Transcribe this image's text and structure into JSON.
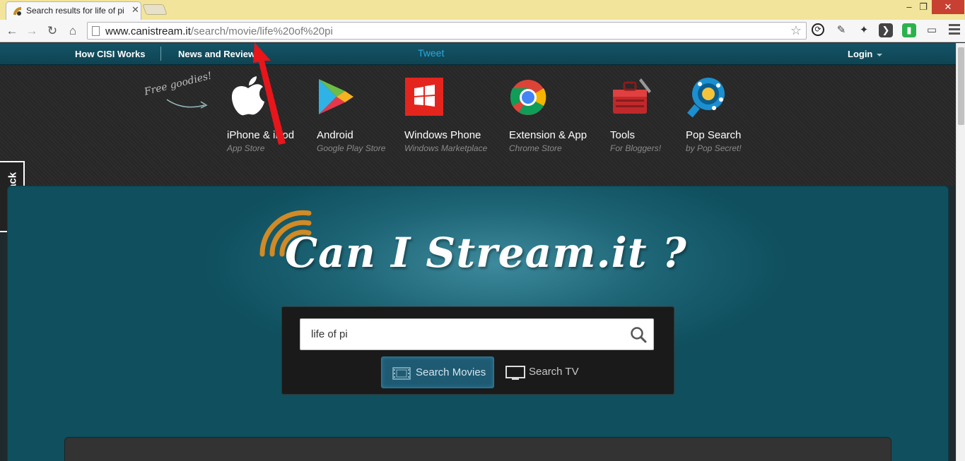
{
  "browser": {
    "tab_title": "Search results for life of pi",
    "url_host": "www.canistream.it",
    "url_path": "/search/movie/life%20of%20pi"
  },
  "site_nav": {
    "how_link": "How CISI Works",
    "news_link": "News and Reviews",
    "tweet": "Tweet",
    "login": "Login"
  },
  "goodies": {
    "tag": "Free goodies!",
    "apps": [
      {
        "name": "iPhone & iPod",
        "sub": "App Store"
      },
      {
        "name": "Android",
        "sub": "Google Play Store"
      },
      {
        "name": "Windows Phone",
        "sub": "Windows Marketplace"
      },
      {
        "name": "Extension & App",
        "sub": "Chrome Store"
      },
      {
        "name": "Tools",
        "sub": "For Bloggers!"
      },
      {
        "name": "Pop Search",
        "sub": "by Pop Secret!"
      }
    ]
  },
  "feedback": "Feedback",
  "hero": {
    "logo_text": "Can I Stream.it ?",
    "search_value": "life of pi",
    "btn_movies": "Search Movies",
    "btn_tv": "Search TV"
  },
  "colors": {
    "tabstrip": "#f2e49a",
    "nav_bar": "#145466",
    "hero_teal": "#1c6374",
    "tweet_blue": "#2aa8e0",
    "annotation_red": "#e8151b"
  }
}
